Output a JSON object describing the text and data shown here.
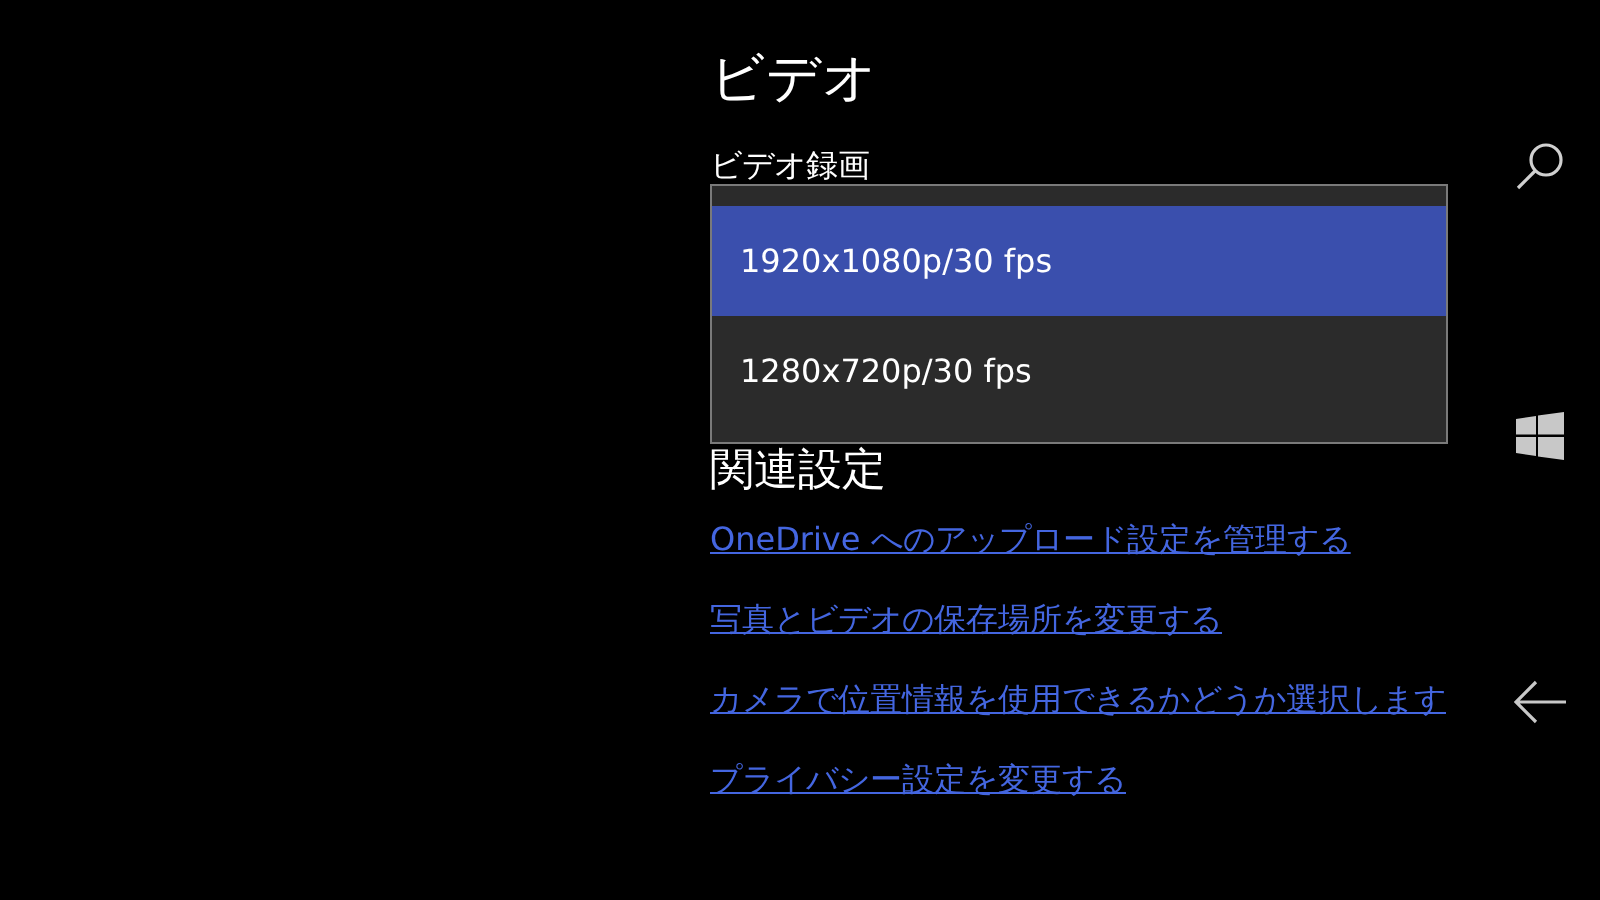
{
  "page_title": "ビデオ",
  "setting_label": "ビデオ録画",
  "dropdown": {
    "expanded": true,
    "options": [
      {
        "label": "1920x1080p/30 fps",
        "selected": true
      },
      {
        "label": "1280x720p/30 fps",
        "selected": false
      }
    ]
  },
  "related_heading": "関連設定",
  "links": [
    {
      "label": "OneDrive へのアップロード設定を管理する"
    },
    {
      "label": "写真とビデオの保存場所を変更する"
    },
    {
      "label": "カメラで位置情報を使用できるかどうか選択します"
    },
    {
      "label": "プライバシー設定を変更する"
    }
  ],
  "nav_bar": [
    {
      "kind": "search"
    },
    {
      "kind": "start"
    },
    {
      "kind": "back"
    }
  ]
}
